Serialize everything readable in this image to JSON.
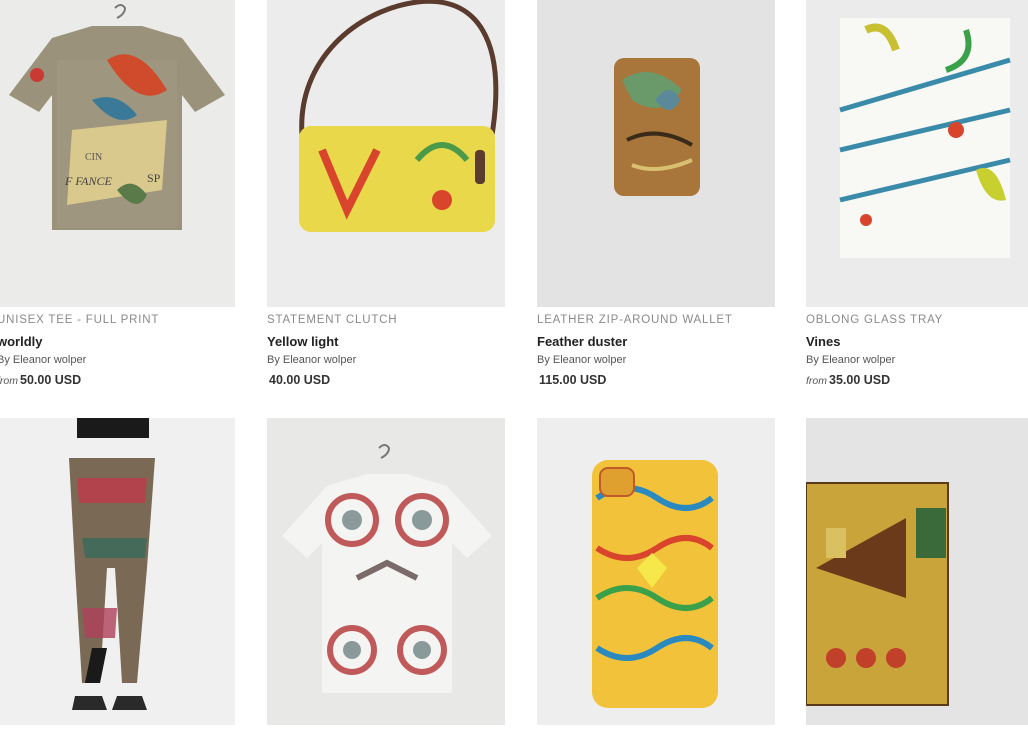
{
  "products": [
    {
      "type": "UNISEX TEE - FULL PRINT",
      "title": "worldly",
      "by": "By Eleanor wolper",
      "from": "from",
      "price": "50.00 USD"
    },
    {
      "type": "STATEMENT CLUTCH",
      "title": "Yellow light",
      "by": "By Eleanor wolper",
      "from": "",
      "price": "40.00 USD"
    },
    {
      "type": "LEATHER ZIP-AROUND WALLET",
      "title": "Feather duster",
      "by": "By Eleanor wolper",
      "from": "",
      "price": "115.00 USD"
    },
    {
      "type": "OBLONG GLASS TRAY",
      "title": "Vines",
      "by": "By Eleanor wolper",
      "from": "from",
      "price": "35.00 USD"
    }
  ],
  "image_labels": {
    "tee_print": [
      "CIN",
      "F FANCE",
      "SP"
    ]
  }
}
